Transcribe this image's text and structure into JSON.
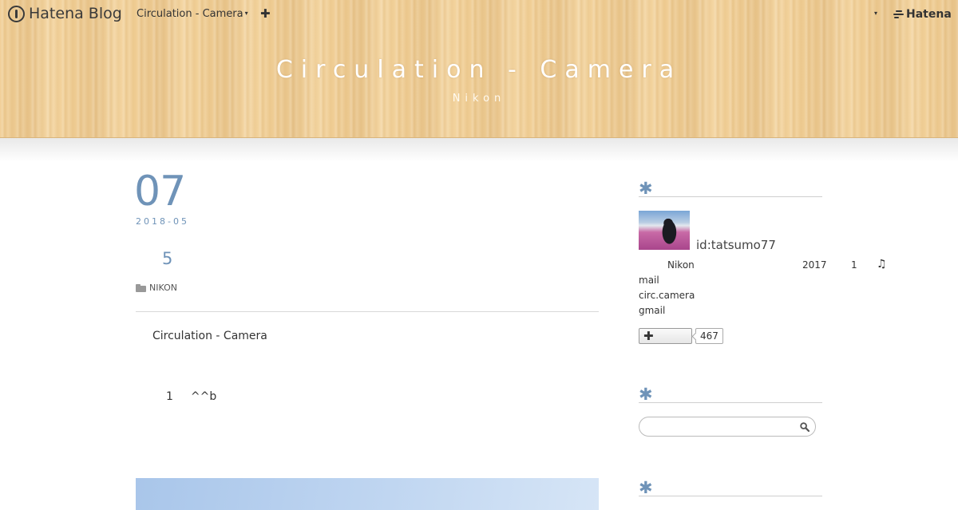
{
  "navbar": {
    "logo_text": "Hatena Blog",
    "blog_menu_label": "Circulation - Camera",
    "caret_glyph": "▾",
    "add_glyph": "✚",
    "right_caret_glyph": "▾",
    "hatena_label": "Hatena"
  },
  "header": {
    "title": "Circulation - Camera",
    "subtitle": "Nikon"
  },
  "entry": {
    "day": "07",
    "year_month": "2018-05",
    "title": "5",
    "category": "NIKON",
    "body_line_1": "Circulation - Camera",
    "body_line_2a": "1",
    "body_line_2b": "^^b"
  },
  "sidebar": {
    "module_glyph": "✱",
    "profile": {
      "id": "id:tatsumo77",
      "desc_a": "Nikon",
      "desc_b": "2017",
      "desc_c": "1",
      "desc_d": "♫",
      "line_1": "mail",
      "line_2": "circ.camera",
      "line_3": "gmail"
    },
    "subscribe": {
      "plus_glyph": "✚",
      "count": "467"
    },
    "search": {
      "placeholder": ""
    }
  },
  "colors": {
    "accent": "#6f93b8",
    "header_wood": "#f1cf96"
  }
}
